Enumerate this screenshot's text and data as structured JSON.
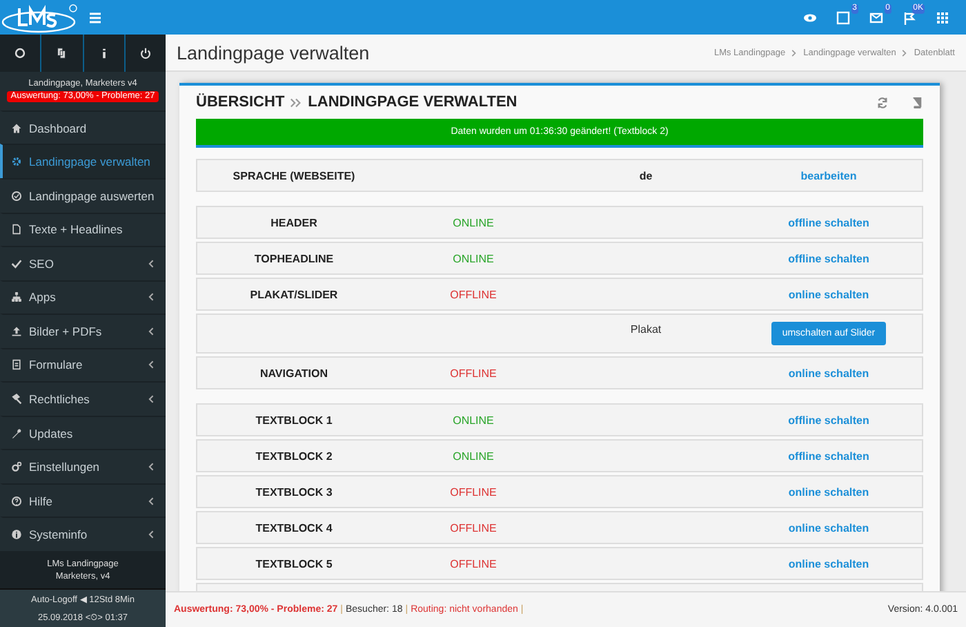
{
  "topbar": {
    "badges": [
      "3",
      "0",
      "0K"
    ]
  },
  "sidebar": {
    "user": "Landingpage, Marketers v4",
    "alert": "Auswertung: 73,00% - Probleme: 27",
    "items": [
      {
        "label": "Dashboard",
        "selected": false,
        "submenu": false
      },
      {
        "label": "Landingpage verwalten",
        "selected": true,
        "submenu": false
      },
      {
        "label": "Landingpage auswerten",
        "selected": false,
        "submenu": false
      },
      {
        "label": "Texte + Headlines",
        "selected": false,
        "submenu": false
      },
      {
        "label": "SEO",
        "selected": false,
        "submenu": true
      },
      {
        "label": "Apps",
        "selected": false,
        "submenu": true
      },
      {
        "label": "Bilder + PDFs",
        "selected": false,
        "submenu": true
      },
      {
        "label": "Formulare",
        "selected": false,
        "submenu": true
      },
      {
        "label": "Rechtliches",
        "selected": false,
        "submenu": true
      },
      {
        "label": "Updates",
        "selected": false,
        "submenu": false
      },
      {
        "label": "Einstellungen",
        "selected": false,
        "submenu": true
      },
      {
        "label": "Hilfe",
        "selected": false,
        "submenu": true
      },
      {
        "label": "Systeminfo",
        "selected": false,
        "submenu": true
      }
    ],
    "footer_lines": [
      "LMs Landingpage",
      "Marketers, v4"
    ],
    "logoff": "Auto-Logoff ◀ 12Std 8Min",
    "clock": "25.09.2018 <⏲> 01:37"
  },
  "page": {
    "title": "Landingpage verwalten",
    "breadcrumb": [
      "LMs Landingpage",
      "Landingpage verwalten",
      "Datenblatt"
    ]
  },
  "panel": {
    "title": "ÜBERSICHT",
    "subtitle": "LANDINGPAGE VERWALTEN",
    "message": "Daten wurden um 01:36:30 geändert! (Textblock 2)",
    "groups": [
      [
        {
          "kind": "setting",
          "label": "SPRACHE (WEBSEITE)",
          "value": "de",
          "action": "bearbeiten"
        }
      ],
      [
        {
          "kind": "block",
          "label": "HEADER",
          "status": "ONLINE",
          "online": true,
          "action": "offline schalten"
        },
        {
          "kind": "block",
          "label": "TOPHEADLINE",
          "status": "ONLINE",
          "online": true,
          "action": "offline schalten"
        },
        {
          "kind": "block",
          "label": "PLAKAT/SLIDER",
          "status": "OFFLINE",
          "online": false,
          "action": "online schalten"
        },
        {
          "kind": "option",
          "value": "Plakat",
          "button": "umschalten auf Slider"
        },
        {
          "kind": "block",
          "label": "NAVIGATION",
          "status": "OFFLINE",
          "online": false,
          "action": "online schalten"
        }
      ],
      [
        {
          "kind": "block",
          "label": "TEXTBLOCK 1",
          "status": "ONLINE",
          "online": true,
          "action": "offline schalten"
        },
        {
          "kind": "block",
          "label": "TEXTBLOCK 2",
          "status": "ONLINE",
          "online": true,
          "action": "offline schalten"
        },
        {
          "kind": "block",
          "label": "TEXTBLOCK 3",
          "status": "OFFLINE",
          "online": false,
          "action": "online schalten"
        },
        {
          "kind": "block",
          "label": "TEXTBLOCK 4",
          "status": "OFFLINE",
          "online": false,
          "action": "online schalten"
        },
        {
          "kind": "block",
          "label": "TEXTBLOCK 5",
          "status": "OFFLINE",
          "online": false,
          "action": "online schalten"
        },
        {
          "kind": "empty"
        }
      ]
    ]
  },
  "status_bar": {
    "items": [
      {
        "kind": "alert",
        "text": "Auswertung: 73,00% - Probleme: 27"
      },
      {
        "kind": "sep",
        "text": "|"
      },
      {
        "kind": "plain",
        "text": "Besucher: 18"
      },
      {
        "kind": "sep",
        "text": "|"
      },
      {
        "kind": "warn",
        "text": "Routing: nicht vorhanden"
      },
      {
        "kind": "sep",
        "text": "|"
      }
    ],
    "version": "Version: 4.0.001"
  }
}
